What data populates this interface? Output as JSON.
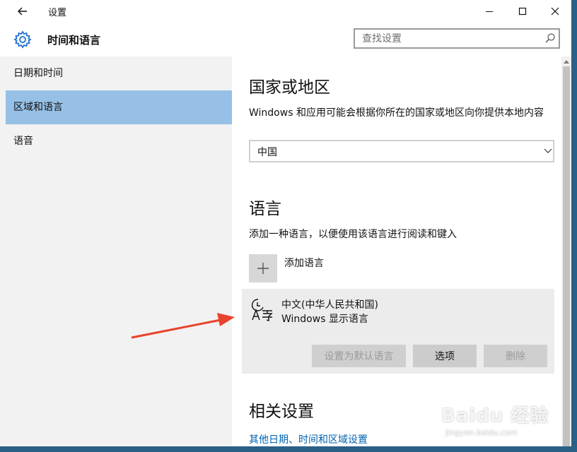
{
  "titlebar": {
    "app_title": "设置",
    "back_icon": "back-arrow-icon",
    "minimize_icon": "minimize-icon",
    "maximize_icon": "maximize-icon",
    "close_icon": "close-icon"
  },
  "header": {
    "icon": "gear-icon",
    "title": "时间和语言",
    "search_placeholder": "查找设置",
    "search_icon": "search-icon"
  },
  "sidebar": {
    "items": [
      {
        "label": "日期和时间",
        "selected": false
      },
      {
        "label": "区域和语言",
        "selected": true
      },
      {
        "label": "语音",
        "selected": false
      }
    ]
  },
  "main": {
    "region_heading": "国家或地区",
    "region_desc": "Windows 和应用可能会根据你所在的国家或地区向你提供本地内容",
    "region_value": "中国",
    "language_heading": "语言",
    "language_desc": "添加一种语言，以便使用该语言进行阅读和键入",
    "add_language_label": "添加语言",
    "language_card": {
      "icon": "language-icon",
      "name": "中文(中华人民共和国)",
      "subtitle": "Windows 显示语言",
      "btn_set_default": "设置为默认语言",
      "btn_options": "选项",
      "btn_remove": "删除"
    },
    "related_heading": "相关设置",
    "related_link": "其他日期、时间和区域设置"
  },
  "watermark": {
    "brand": "Baidu 经验",
    "url": "jingyan.baidu.com"
  },
  "colors": {
    "sidebar_bg": "#f2f2f2",
    "selected_bg": "#96c0e6",
    "link": "#0063b1",
    "annotation_arrow": "#e8432e",
    "desktop": "#2a5f86"
  }
}
